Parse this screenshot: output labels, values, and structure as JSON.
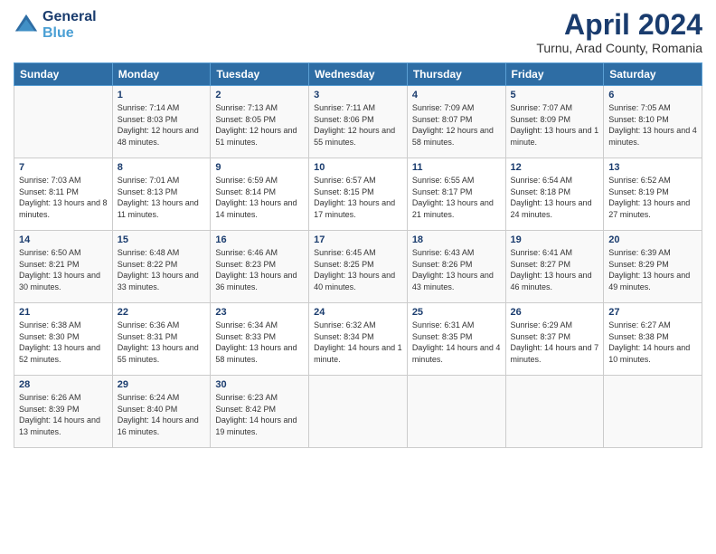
{
  "header": {
    "logo_line1": "General",
    "logo_line2": "Blue",
    "month_title": "April 2024",
    "subtitle": "Turnu, Arad County, Romania"
  },
  "days_of_week": [
    "Sunday",
    "Monday",
    "Tuesday",
    "Wednesday",
    "Thursday",
    "Friday",
    "Saturday"
  ],
  "weeks": [
    [
      {
        "num": "",
        "sunrise": "",
        "sunset": "",
        "daylight": ""
      },
      {
        "num": "1",
        "sunrise": "Sunrise: 7:14 AM",
        "sunset": "Sunset: 8:03 PM",
        "daylight": "Daylight: 12 hours and 48 minutes."
      },
      {
        "num": "2",
        "sunrise": "Sunrise: 7:13 AM",
        "sunset": "Sunset: 8:05 PM",
        "daylight": "Daylight: 12 hours and 51 minutes."
      },
      {
        "num": "3",
        "sunrise": "Sunrise: 7:11 AM",
        "sunset": "Sunset: 8:06 PM",
        "daylight": "Daylight: 12 hours and 55 minutes."
      },
      {
        "num": "4",
        "sunrise": "Sunrise: 7:09 AM",
        "sunset": "Sunset: 8:07 PM",
        "daylight": "Daylight: 12 hours and 58 minutes."
      },
      {
        "num": "5",
        "sunrise": "Sunrise: 7:07 AM",
        "sunset": "Sunset: 8:09 PM",
        "daylight": "Daylight: 13 hours and 1 minute."
      },
      {
        "num": "6",
        "sunrise": "Sunrise: 7:05 AM",
        "sunset": "Sunset: 8:10 PM",
        "daylight": "Daylight: 13 hours and 4 minutes."
      }
    ],
    [
      {
        "num": "7",
        "sunrise": "Sunrise: 7:03 AM",
        "sunset": "Sunset: 8:11 PM",
        "daylight": "Daylight: 13 hours and 8 minutes."
      },
      {
        "num": "8",
        "sunrise": "Sunrise: 7:01 AM",
        "sunset": "Sunset: 8:13 PM",
        "daylight": "Daylight: 13 hours and 11 minutes."
      },
      {
        "num": "9",
        "sunrise": "Sunrise: 6:59 AM",
        "sunset": "Sunset: 8:14 PM",
        "daylight": "Daylight: 13 hours and 14 minutes."
      },
      {
        "num": "10",
        "sunrise": "Sunrise: 6:57 AM",
        "sunset": "Sunset: 8:15 PM",
        "daylight": "Daylight: 13 hours and 17 minutes."
      },
      {
        "num": "11",
        "sunrise": "Sunrise: 6:55 AM",
        "sunset": "Sunset: 8:17 PM",
        "daylight": "Daylight: 13 hours and 21 minutes."
      },
      {
        "num": "12",
        "sunrise": "Sunrise: 6:54 AM",
        "sunset": "Sunset: 8:18 PM",
        "daylight": "Daylight: 13 hours and 24 minutes."
      },
      {
        "num": "13",
        "sunrise": "Sunrise: 6:52 AM",
        "sunset": "Sunset: 8:19 PM",
        "daylight": "Daylight: 13 hours and 27 minutes."
      }
    ],
    [
      {
        "num": "14",
        "sunrise": "Sunrise: 6:50 AM",
        "sunset": "Sunset: 8:21 PM",
        "daylight": "Daylight: 13 hours and 30 minutes."
      },
      {
        "num": "15",
        "sunrise": "Sunrise: 6:48 AM",
        "sunset": "Sunset: 8:22 PM",
        "daylight": "Daylight: 13 hours and 33 minutes."
      },
      {
        "num": "16",
        "sunrise": "Sunrise: 6:46 AM",
        "sunset": "Sunset: 8:23 PM",
        "daylight": "Daylight: 13 hours and 36 minutes."
      },
      {
        "num": "17",
        "sunrise": "Sunrise: 6:45 AM",
        "sunset": "Sunset: 8:25 PM",
        "daylight": "Daylight: 13 hours and 40 minutes."
      },
      {
        "num": "18",
        "sunrise": "Sunrise: 6:43 AM",
        "sunset": "Sunset: 8:26 PM",
        "daylight": "Daylight: 13 hours and 43 minutes."
      },
      {
        "num": "19",
        "sunrise": "Sunrise: 6:41 AM",
        "sunset": "Sunset: 8:27 PM",
        "daylight": "Daylight: 13 hours and 46 minutes."
      },
      {
        "num": "20",
        "sunrise": "Sunrise: 6:39 AM",
        "sunset": "Sunset: 8:29 PM",
        "daylight": "Daylight: 13 hours and 49 minutes."
      }
    ],
    [
      {
        "num": "21",
        "sunrise": "Sunrise: 6:38 AM",
        "sunset": "Sunset: 8:30 PM",
        "daylight": "Daylight: 13 hours and 52 minutes."
      },
      {
        "num": "22",
        "sunrise": "Sunrise: 6:36 AM",
        "sunset": "Sunset: 8:31 PM",
        "daylight": "Daylight: 13 hours and 55 minutes."
      },
      {
        "num": "23",
        "sunrise": "Sunrise: 6:34 AM",
        "sunset": "Sunset: 8:33 PM",
        "daylight": "Daylight: 13 hours and 58 minutes."
      },
      {
        "num": "24",
        "sunrise": "Sunrise: 6:32 AM",
        "sunset": "Sunset: 8:34 PM",
        "daylight": "Daylight: 14 hours and 1 minute."
      },
      {
        "num": "25",
        "sunrise": "Sunrise: 6:31 AM",
        "sunset": "Sunset: 8:35 PM",
        "daylight": "Daylight: 14 hours and 4 minutes."
      },
      {
        "num": "26",
        "sunrise": "Sunrise: 6:29 AM",
        "sunset": "Sunset: 8:37 PM",
        "daylight": "Daylight: 14 hours and 7 minutes."
      },
      {
        "num": "27",
        "sunrise": "Sunrise: 6:27 AM",
        "sunset": "Sunset: 8:38 PM",
        "daylight": "Daylight: 14 hours and 10 minutes."
      }
    ],
    [
      {
        "num": "28",
        "sunrise": "Sunrise: 6:26 AM",
        "sunset": "Sunset: 8:39 PM",
        "daylight": "Daylight: 14 hours and 13 minutes."
      },
      {
        "num": "29",
        "sunrise": "Sunrise: 6:24 AM",
        "sunset": "Sunset: 8:40 PM",
        "daylight": "Daylight: 14 hours and 16 minutes."
      },
      {
        "num": "30",
        "sunrise": "Sunrise: 6:23 AM",
        "sunset": "Sunset: 8:42 PM",
        "daylight": "Daylight: 14 hours and 19 minutes."
      },
      {
        "num": "",
        "sunrise": "",
        "sunset": "",
        "daylight": ""
      },
      {
        "num": "",
        "sunrise": "",
        "sunset": "",
        "daylight": ""
      },
      {
        "num": "",
        "sunrise": "",
        "sunset": "",
        "daylight": ""
      },
      {
        "num": "",
        "sunrise": "",
        "sunset": "",
        "daylight": ""
      }
    ]
  ]
}
